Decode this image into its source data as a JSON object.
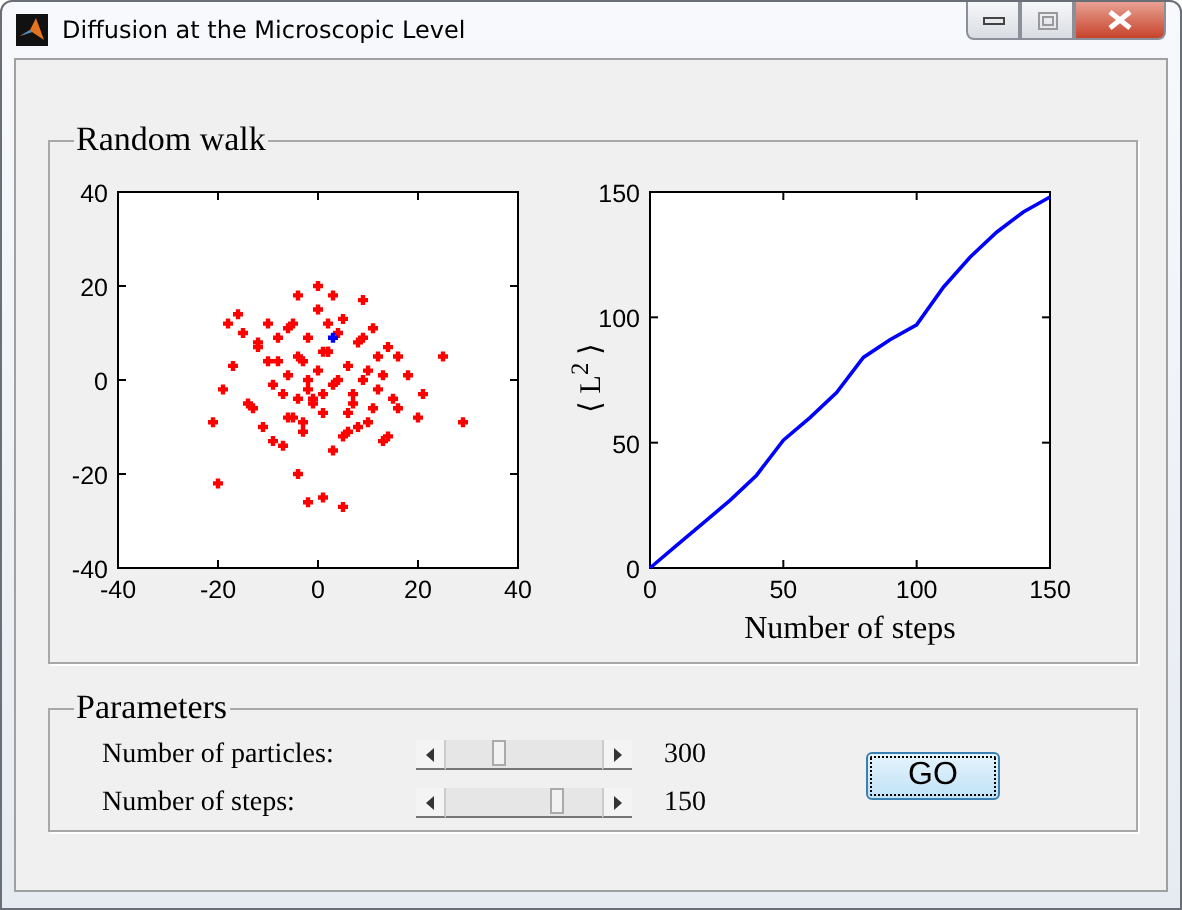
{
  "window": {
    "title": "Diffusion at the Microscopic Level"
  },
  "random_walk": {
    "title": "Random walk",
    "scatter": {
      "chart_data": {
        "type": "scatter",
        "xlim": [
          -40,
          40
        ],
        "ylim": [
          -40,
          40
        ],
        "xticks": [
          -40,
          -20,
          0,
          20,
          40
        ],
        "yticks": [
          -40,
          -20,
          0,
          20,
          40
        ],
        "x": [
          -21,
          -20,
          29,
          25,
          21,
          -4,
          -2,
          1,
          5,
          0,
          -4,
          3,
          9,
          -16,
          -18,
          20,
          18,
          -19,
          -17,
          -15,
          -13,
          -12,
          -11,
          -10,
          -9,
          -8,
          -7,
          -6,
          -5,
          -4,
          -3,
          -2,
          -1,
          0,
          1,
          2,
          3,
          4,
          5,
          6,
          7,
          8,
          9,
          10,
          11,
          12,
          13,
          14,
          15,
          16,
          -14,
          -12,
          -9,
          -7,
          -5,
          -3,
          -1,
          1,
          3,
          5,
          7,
          9,
          11,
          13,
          -10,
          -6,
          -2,
          2,
          6,
          10,
          14,
          -8,
          -4,
          0,
          4,
          8,
          12,
          16,
          -6,
          -2,
          2,
          6,
          -3,
          1,
          3
        ],
        "series": [
          {
            "color": "#ff0000",
            "values": [
              -9,
              -22,
              -9,
              5,
              -3,
              -20,
              -26,
              -25,
              -27,
              20,
              18,
              18,
              17,
              14,
              12,
              -8,
              1,
              -2,
              3,
              10,
              -6,
              7,
              -10,
              12,
              -13,
              4,
              -3,
              11,
              -8,
              5,
              -11,
              9,
              -4,
              2,
              -7,
              6,
              -1,
              10,
              -12,
              3,
              -5,
              8,
              0,
              -9,
              11,
              -2,
              -13,
              7,
              -4,
              5,
              -5,
              8,
              -1,
              -14,
              12,
              -9,
              -5,
              6,
              -15,
              13,
              -3,
              9,
              -6,
              1,
              4,
              -8,
              0,
              12,
              -11,
              2,
              -12,
              9,
              -4,
              15,
              0,
              -10,
              5,
              -6,
              1,
              -2,
              6,
              -7,
              4,
              -3,
              null
            ]
          },
          {
            "color": "#0000ff",
            "values": [
              null,
              null,
              null,
              null,
              null,
              null,
              null,
              null,
              null,
              null,
              null,
              null,
              null,
              null,
              null,
              null,
              null,
              null,
              null,
              null,
              null,
              null,
              null,
              null,
              null,
              null,
              null,
              null,
              null,
              null,
              null,
              null,
              null,
              null,
              null,
              null,
              null,
              null,
              null,
              null,
              null,
              null,
              null,
              null,
              null,
              null,
              null,
              null,
              null,
              null,
              null,
              null,
              null,
              null,
              null,
              null,
              null,
              null,
              null,
              null,
              null,
              null,
              null,
              null,
              null,
              null,
              null,
              null,
              null,
              null,
              null,
              null,
              null,
              null,
              null,
              null,
              null,
              null,
              null,
              null,
              null,
              null,
              null,
              null,
              9
            ]
          }
        ]
      }
    },
    "msd": {
      "chart_data": {
        "type": "line",
        "xlabel": "Number of steps",
        "ylabel": "⟨ L$^{2}$ ⟩",
        "xlim": [
          0,
          150
        ],
        "ylim": [
          0,
          150
        ],
        "xticks": [
          0,
          50,
          100,
          150
        ],
        "yticks": [
          0,
          50,
          100,
          150
        ],
        "x": [
          0,
          10,
          20,
          30,
          40,
          50,
          60,
          70,
          80,
          90,
          100,
          110,
          120,
          130,
          140,
          150
        ],
        "series": [
          {
            "color": "#0000ff",
            "values": [
              0,
              9,
              18,
              27,
              37,
              51,
              60,
              70,
              84,
              91,
              97,
              112,
              124,
              134,
              142,
              148
            ]
          }
        ]
      }
    }
  },
  "parameters": {
    "title": "Parameters",
    "sliders": [
      {
        "label": "Number of particles:",
        "level": 0.32,
        "value": "300"
      },
      {
        "label": "Number of steps:",
        "level": 0.73,
        "value": "150"
      }
    ],
    "go_button": "GO"
  }
}
